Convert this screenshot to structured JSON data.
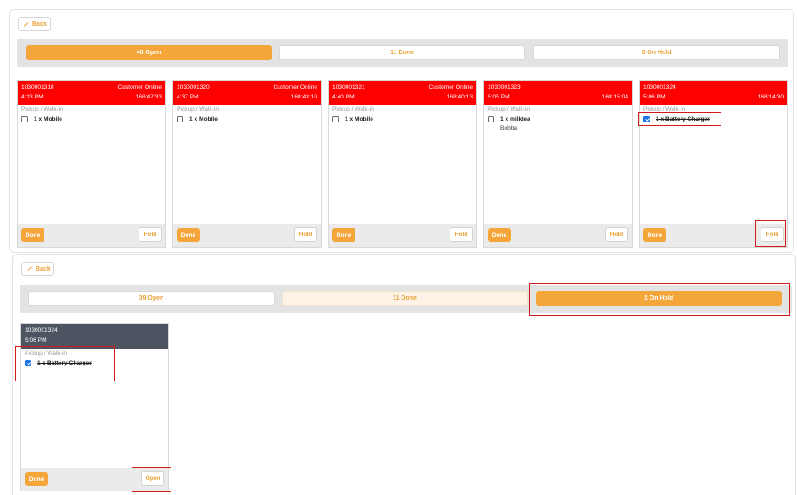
{
  "top": {
    "back_label": "Back",
    "tabs": [
      {
        "label": "40 Open",
        "state": "active"
      },
      {
        "label": "11 Done",
        "state": "default"
      },
      {
        "label": "0 On Hold",
        "state": "default"
      }
    ],
    "orders": [
      {
        "id": "1030001318",
        "time": "4:33 PM",
        "source": "Customer Online",
        "elapsed": "168:47:33",
        "type": "Pickup / Walk-in",
        "items": [
          {
            "text": "1 x Mobile",
            "checked": false
          }
        ],
        "done_label": "Done",
        "hold_label": "Hold"
      },
      {
        "id": "1030001320",
        "time": "4:37 PM",
        "source": "Customer Online",
        "elapsed": "168:43:10",
        "type": "Pickup / Walk-in",
        "items": [
          {
            "text": "1 x Mobile",
            "checked": false
          }
        ],
        "done_label": "Done",
        "hold_label": "Hold"
      },
      {
        "id": "1030001321",
        "time": "4:40 PM",
        "source": "Customer Online",
        "elapsed": "168:40:13",
        "type": "Pickup / Walk-in",
        "items": [
          {
            "text": "1 x Mobile",
            "checked": false
          }
        ],
        "done_label": "Done",
        "hold_label": "Hold"
      },
      {
        "id": "1030001323",
        "time": "5:05 PM",
        "source": "",
        "elapsed": "168:15:04",
        "type": "Pickup / Walk-in",
        "items": [
          {
            "text": "1 x milktea",
            "checked": false,
            "note": "Bobba"
          }
        ],
        "done_label": "Done",
        "hold_label": "Hold"
      },
      {
        "id": "1030001324",
        "time": "5:06 PM",
        "source": "",
        "elapsed": "168:14:30",
        "type": "Pickup / Walk-in",
        "items": [
          {
            "text": "1 x Battery Charger",
            "checked": true
          }
        ],
        "done_label": "Done",
        "hold_label": "Hold"
      }
    ]
  },
  "bottom": {
    "back_label": "Back",
    "tabs": [
      {
        "label": "39 Open",
        "state": "default"
      },
      {
        "label": "11 Done",
        "state": "soft"
      },
      {
        "label": "1 On Hold",
        "state": "active"
      }
    ],
    "order": {
      "id": "1030001324",
      "time": "5:06 PM",
      "type": "Pickup / Walk-in",
      "items": [
        {
          "text": "1 x Battery Charger",
          "checked": true
        }
      ],
      "done_label": "Done",
      "open_label": "Open"
    }
  },
  "colors": {
    "accent": "#f5a63a",
    "header_red": "#ff0000",
    "header_hold": "#4d5562",
    "highlight": "#d11a1a",
    "checkbox": "#1a73e8"
  }
}
